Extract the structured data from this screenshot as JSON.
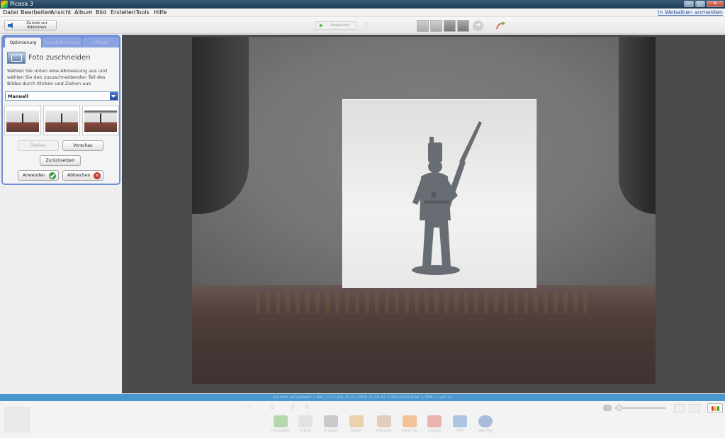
{
  "window": {
    "title": "Picasa 3"
  },
  "menu": {
    "items": [
      "Datei",
      "Bearbeiten",
      "Ansicht",
      "Album",
      "Bild",
      "Erstellen",
      "Tools",
      "Hilfe"
    ],
    "web_login": "In Webalben anmelden"
  },
  "toolbar": {
    "back_label": "Zurück zur Bibliothek",
    "play_label": "Abspielen"
  },
  "panel": {
    "tabs": [
      "Optimierung",
      "Feinabstimmung",
      "Effekte"
    ],
    "crop_title": "Foto zuschneiden",
    "crop_description": "Wählen Sie unten eine Abmessung aus und wählen Sie den zuzuschneidenden Teil des Bildes durch Klicken und Ziehen aus.",
    "aspect_value": "Manuell",
    "buttons": {
      "rotate": "Drehen",
      "preview": "Vorschau",
      "reset": "Zurücksetzen",
      "apply": "Anwenden",
      "cancel": "Abbrechen"
    }
  },
  "status": {
    "text": "Kürzlich aktualisiert • IMG_1111.JPG   26.02.2008 21:56:47   3264x2448 Pixel   2,3MB   (1 von 4)"
  },
  "tray": {
    "buttons": [
      "Hochladen",
      "E-Mail",
      "Drucken",
      "Export",
      "Einkaufen",
      "BlogThis!",
      "Collage",
      "Film",
      "Geo-Tag"
    ]
  },
  "colors": {
    "accent": "#6f8fd8",
    "status_bar": "#4a96cf",
    "apply_icon": "#2f9a35",
    "cancel_icon": "#c63a2d"
  }
}
